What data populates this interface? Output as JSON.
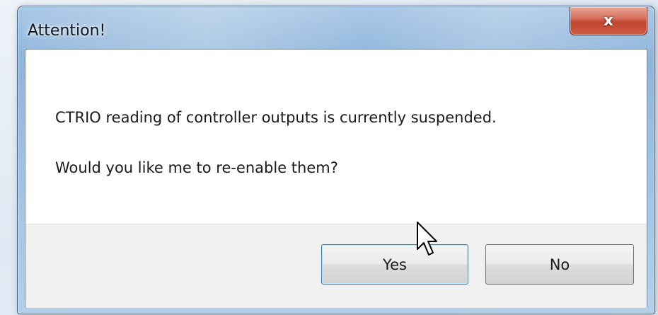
{
  "dialog": {
    "title": "Attention!",
    "close_label": "x",
    "message_line1": "CTRIO reading of controller outputs is currently suspended.",
    "message_line2": "Would you like me to re-enable them?"
  },
  "buttons": {
    "yes_label": "Yes",
    "no_label": "No"
  },
  "colors": {
    "close_button": "#c2452f",
    "button_bar": "#f0f0f0",
    "default_button_border": "#3c7fb1"
  },
  "icons": {
    "close": "close-icon",
    "cursor": "mouse-pointer-icon"
  }
}
